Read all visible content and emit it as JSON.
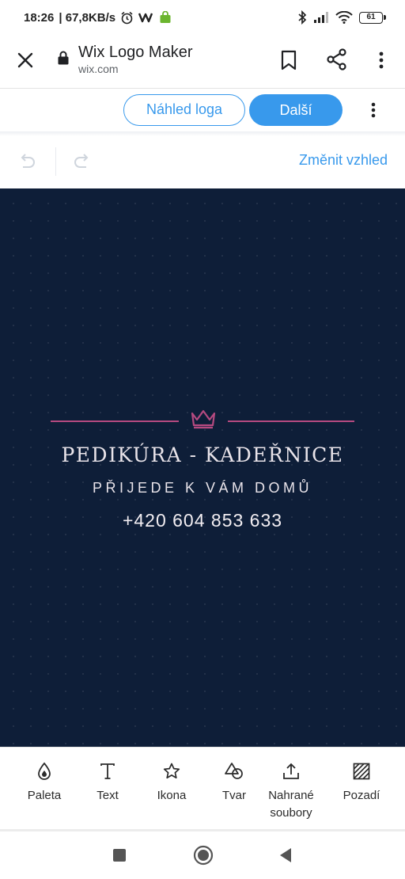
{
  "status_bar": {
    "time": "18:26",
    "net_speed": "| 67,8KB/s",
    "battery": "61"
  },
  "browser": {
    "page_title": "Wix Logo Maker",
    "domain": "wix.com"
  },
  "wix_bar": {
    "preview_label": "Náhled loga",
    "next_label": "Další"
  },
  "edit_bar": {
    "change_look": "Změnit vzhled"
  },
  "logo": {
    "name": "PEDIKÚRA - KADEŘNICE",
    "tagline": "PŘIJEDE K VÁM DOMŮ",
    "phone": "+420 604  853 633",
    "background_color": "#0e1e38",
    "accent_color": "#b54a80"
  },
  "toolbar": {
    "palette": "Paleta",
    "text": "Text",
    "icon": "Ikona",
    "shape": "Tvar",
    "uploads_line1": "Nahrané",
    "uploads_line2": "soubory",
    "background": "Pozadí"
  },
  "colors": {
    "wix_blue": "#3899ec"
  }
}
